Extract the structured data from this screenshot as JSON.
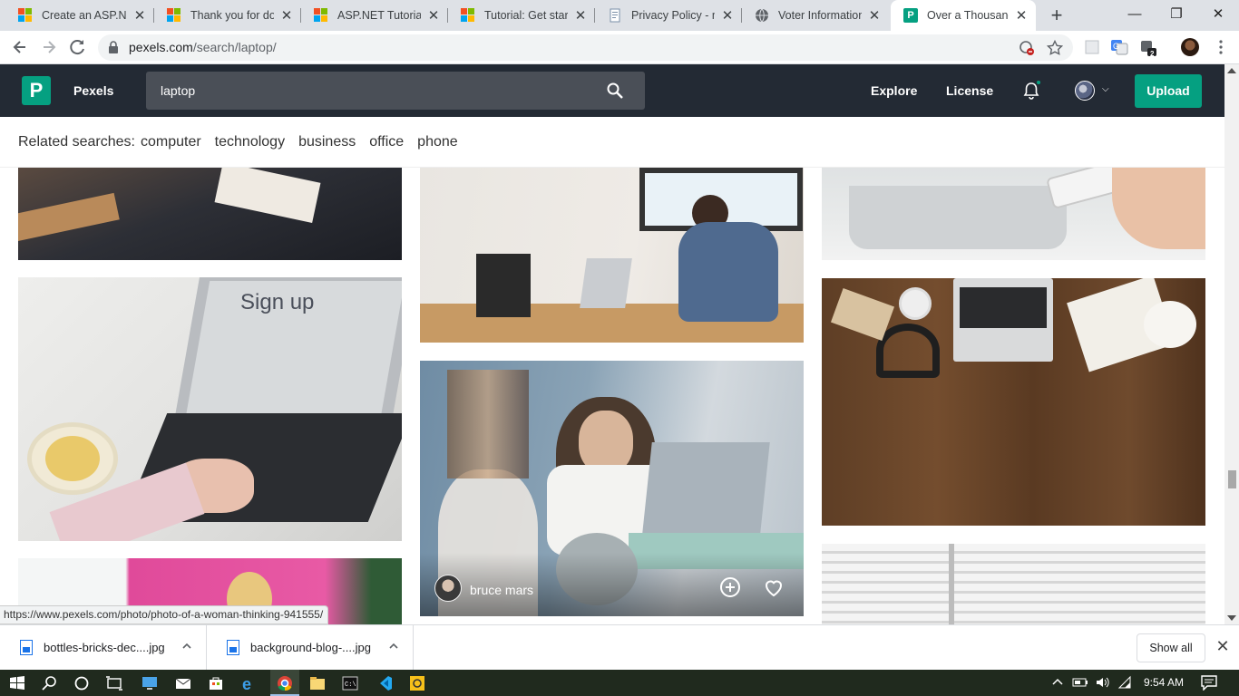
{
  "browser": {
    "tabs": [
      {
        "title": "Create an ASP.NET",
        "icon": "microsoft-icon"
      },
      {
        "title": "Thank you for dow",
        "icon": "microsoft-icon"
      },
      {
        "title": "ASP.NET Tutorial |",
        "icon": "microsoft-icon"
      },
      {
        "title": "Tutorial: Get starte",
        "icon": "microsoft-icon"
      },
      {
        "title": "Privacy Policy - my",
        "icon": "document-icon"
      },
      {
        "title": "Voter Information",
        "icon": "globe-icon"
      },
      {
        "title": "Over a Thousand L",
        "icon": "pexels-icon"
      }
    ],
    "new_tab": "+",
    "close_glyph": "✕",
    "window_controls": {
      "minimize": "—",
      "maximize": "❐",
      "close": "✕"
    },
    "url_host": "pexels.com",
    "url_path": "/search/laptop/",
    "extension_badge": "2"
  },
  "site": {
    "brand": "Pexels",
    "logo_letter": "P",
    "search_value": "laptop",
    "nav": {
      "explore": "Explore",
      "license": "License"
    },
    "upload": "Upload",
    "related_label": "Related searches:",
    "related_tags": [
      "computer",
      "technology",
      "business",
      "office",
      "phone"
    ],
    "accent": "#05a081",
    "header_bg": "#232a34"
  },
  "photos": {
    "hovered_author": "bruce mars"
  },
  "status_url": "https://www.pexels.com/photo/photo-of-a-woman-thinking-941555/",
  "downloads": {
    "items": [
      "bottles-bricks-dec....jpg",
      "background-blog-....jpg"
    ],
    "show_all": "Show all",
    "close": "✕"
  },
  "taskbar": {
    "time": "9:54 AM"
  }
}
